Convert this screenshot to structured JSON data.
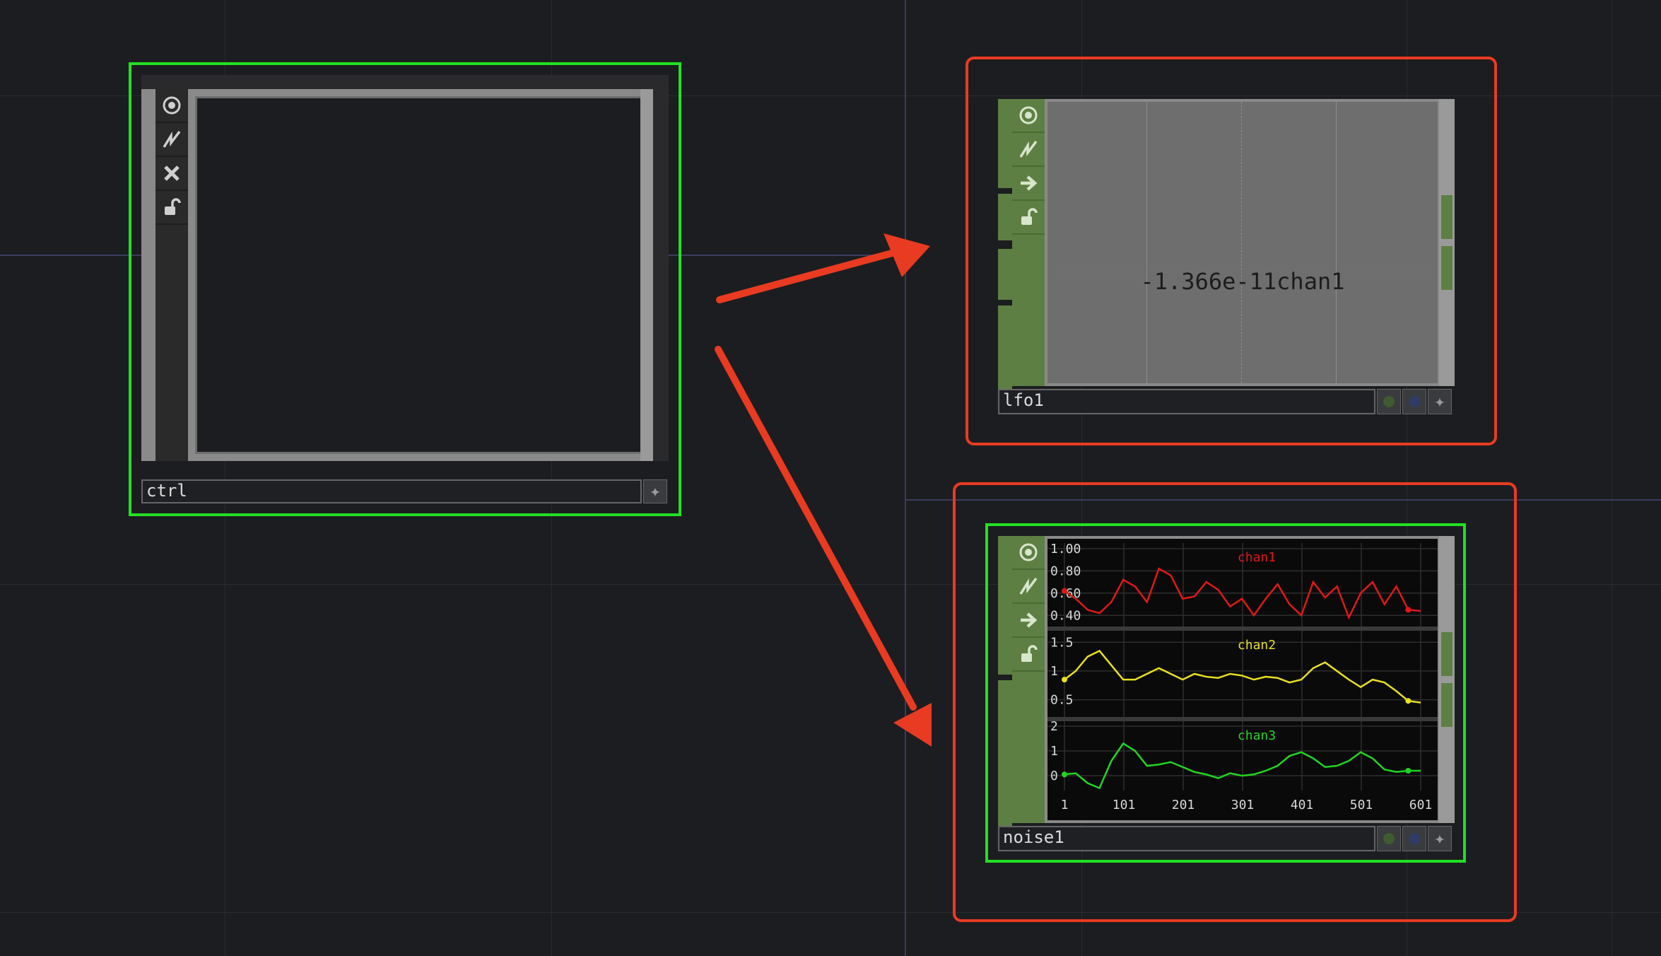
{
  "nodes": {
    "ctrl": {
      "name": "ctrl",
      "buttons": [
        "viewer-icon",
        "bypass-icon",
        "close-icon",
        "lock-icon"
      ]
    },
    "lfo1": {
      "name": "lfo1",
      "value_display": "-1.366e-11chan1",
      "buttons": [
        "viewer-icon",
        "bypass-icon",
        "arrow-right-icon",
        "lock-icon"
      ]
    },
    "noise1": {
      "name": "noise1",
      "buttons": [
        "viewer-icon",
        "bypass-icon",
        "arrow-right-icon",
        "lock-icon"
      ]
    }
  },
  "chart_data": {
    "type": "line",
    "x_ticks": [
      "1",
      "101",
      "201",
      "301",
      "401",
      "501",
      "601"
    ],
    "xlim": [
      1,
      601
    ],
    "grid": true,
    "series": [
      {
        "name": "chan1",
        "color": "#e01818",
        "y_ticks": [
          "1.00",
          "0.80",
          "0.60",
          "0.40"
        ],
        "ylim": [
          0.3,
          1.05
        ],
        "x": [
          1,
          20,
          40,
          60,
          80,
          100,
          120,
          140,
          160,
          180,
          200,
          220,
          240,
          260,
          280,
          300,
          320,
          340,
          360,
          380,
          400,
          420,
          440,
          460,
          480,
          500,
          520,
          540,
          560,
          580,
          601
        ],
        "values": [
          0.62,
          0.55,
          0.45,
          0.42,
          0.52,
          0.72,
          0.66,
          0.52,
          0.82,
          0.76,
          0.55,
          0.57,
          0.7,
          0.63,
          0.48,
          0.55,
          0.4,
          0.55,
          0.68,
          0.5,
          0.4,
          0.7,
          0.56,
          0.66,
          0.38,
          0.6,
          0.7,
          0.5,
          0.66,
          0.45,
          0.44
        ]
      },
      {
        "name": "chan2",
        "color": "#e8e020",
        "y_ticks": [
          "1.5",
          "1",
          "0.5"
        ],
        "ylim": [
          0.2,
          1.7
        ],
        "x": [
          1,
          20,
          40,
          60,
          80,
          100,
          120,
          140,
          160,
          180,
          200,
          220,
          240,
          260,
          280,
          300,
          320,
          340,
          360,
          380,
          400,
          420,
          440,
          460,
          480,
          500,
          520,
          540,
          560,
          580,
          601
        ],
        "values": [
          0.85,
          1.0,
          1.25,
          1.35,
          1.1,
          0.85,
          0.85,
          0.95,
          1.05,
          0.95,
          0.85,
          0.95,
          0.9,
          0.88,
          0.95,
          0.92,
          0.85,
          0.9,
          0.88,
          0.8,
          0.85,
          1.05,
          1.15,
          1.0,
          0.85,
          0.72,
          0.85,
          0.8,
          0.65,
          0.48,
          0.45
        ]
      },
      {
        "name": "chan3",
        "color": "#22d422",
        "y_ticks": [
          "2",
          "1",
          "0"
        ],
        "ylim": [
          -0.6,
          2.2
        ],
        "x": [
          1,
          20,
          40,
          60,
          80,
          100,
          120,
          140,
          160,
          180,
          200,
          220,
          240,
          260,
          280,
          300,
          320,
          340,
          360,
          380,
          400,
          420,
          440,
          460,
          480,
          500,
          520,
          540,
          560,
          580,
          601
        ],
        "values": [
          0.05,
          0.1,
          -0.3,
          -0.5,
          0.6,
          1.3,
          1.0,
          0.4,
          0.45,
          0.55,
          0.35,
          0.15,
          0.05,
          -0.1,
          0.1,
          0.0,
          0.05,
          0.2,
          0.4,
          0.8,
          0.95,
          0.7,
          0.35,
          0.4,
          0.6,
          0.95,
          0.7,
          0.25,
          0.15,
          0.2,
          0.2
        ]
      }
    ]
  }
}
